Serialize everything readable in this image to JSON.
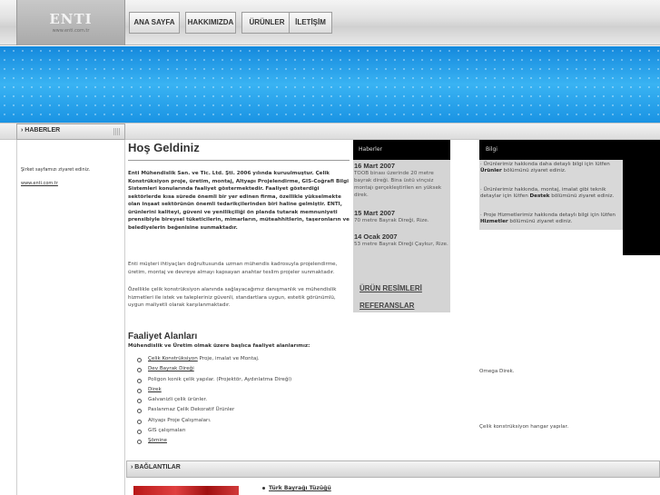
{
  "header": {
    "logo_text": "ENTI",
    "logo_url": "www.enti.com.tr",
    "nav": [
      {
        "label": "ANA SAYFA"
      },
      {
        "label": "HAKKIMIZDA"
      },
      {
        "label": "ÜRÜNLER"
      },
      {
        "label": "İLETİŞİM"
      }
    ]
  },
  "sidebar": {
    "title": "HABERLER",
    "text1": "Şirket sayfamızı ziyaret ediniz.",
    "link": "www.enti.com.tr"
  },
  "main": {
    "title": "Hoş Geldiniz",
    "intro_bold": "Enti Mühendislik San. ve Tic. Ltd. Şti. 2006 yılında kuruulmuştur. Çelik Konstrüksiyon proje, üretim, montaj, Altyapı Projelendirme, GIS-Coğrafi Bilgi Sistemleri konularında faaliyet göstermektedir. Faaliyet gösterdiği sektörlerde kısa sürede önemli bir yer edinen firma, özellikle yükselmekte olan inşaat sektörünün önemli tedarikçilerinden biri haline gelmiştir. ENTI, ürünlerini kaliteyi, güveni ve yenilikçiliği ön planda tutarak memnuniyeti prensibiyle bireysel tüketicilerin, mimarların, müteahhitlerin, taşeronların ve belediyelerin beğenisine sunmaktadır.",
    "intro_p1": "Enti müşteri ihtiyaçları doğrultusunda uzman mühendis kadrosuyla projelendirme, üretim, montaj ve devreye almayı kapsayan anahtar teslim projeler sunmaktadır.",
    "intro_p2": "Özellikle çelik konstrüksiyon alanında sağlayacağımız danışmanlık ve mühendislik hizmetleri ile istek ve talepleriniz güvenli, standartlara uygun, estetik görünümlü, uygun maliyetli olarak karşılanmaktadır.",
    "activity_title": "Faaliyet Alanları",
    "activity_sub": "Mühendislik ve Üretim olmak üzere başlıca faaliyet alanlarımız:",
    "activities": [
      {
        "link": "Çelik Konstrüksiyon",
        "rest": " Proje, imalat ve Montaj."
      },
      {
        "link": "Dev Bayrak Direği",
        "rest": ""
      },
      {
        "link": "",
        "rest": "Poligon konik çelik yapılar. (Projektör, Aydınlatma Direği)"
      },
      {
        "link": "Direk",
        "rest": ""
      },
      {
        "link": "",
        "rest": "Galvanizli çelik ürünler."
      },
      {
        "link": "",
        "rest": "Paslanmaz Çelik Dekoratif Ürünler"
      },
      {
        "link": "",
        "rest": "Altyapı Proje Çalışmaları."
      },
      {
        "link": "",
        "rest": "GIS çalışmaları"
      },
      {
        "link": "Şömine",
        "rest": ""
      }
    ]
  },
  "news": {
    "title": "Haberler",
    "items": [
      {
        "date": "16 Mart 2007",
        "text": "TOOB binası üzerinde 20 metre bayrak direği. Bina üstü vinçsiz montajı gerçekleştirilen en yüksek direk."
      },
      {
        "date": "15 Mart 2007",
        "text": "70 metre Bayrak Direği, Rize."
      },
      {
        "date": "14 Ocak 2007",
        "text": "53 metre Bayrak Direği Çaykur, Rize."
      }
    ],
    "links": [
      "ÜRÜN RESİMLERİ",
      "REFERANSLAR"
    ]
  },
  "info": {
    "title": "Bilgi",
    "items": [
      {
        "pre": "Ürünlerimiz hakkında daha detaylı bilgi için lütfen ",
        "bold": "Ürünler",
        "post": " bölümünü ziyaret ediniz."
      },
      {
        "pre": "Ürünlerimiz hakkında, montaj, imalat gibi teknik detaylar için lütfen ",
        "bold": "Destek",
        "post": " bölümünü ziyaret ediniz."
      },
      {
        "pre": "Proje Hizmetlerimiz hakkında detaylı bilgi için lütfen ",
        "bold": "Hizmetler",
        "post": " bölümünü ziyaret ediniz."
      }
    ],
    "caption1": "Omega Direk.",
    "caption2": "Çelik konstrüksiyon hangar yapılar."
  },
  "links_section": {
    "title": "BAĞLANTILAR",
    "items": [
      "Türk Bayrağı Tüzüğü"
    ]
  }
}
